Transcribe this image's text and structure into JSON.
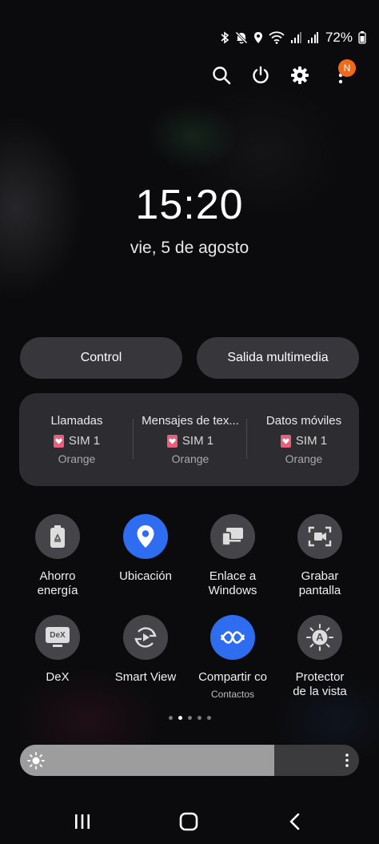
{
  "status_bar": {
    "battery_percent": "72%",
    "icons": [
      "bluetooth-icon",
      "mute-icon",
      "location-icon",
      "wifi-icon",
      "signal-icon",
      "signal-icon-2",
      "battery-icon"
    ]
  },
  "top_actions": {
    "icons": [
      "search-icon",
      "power-icon",
      "settings-icon",
      "more-options-icon"
    ],
    "notification_badge": "N"
  },
  "clock": {
    "time": "15:20",
    "date": "vie, 5 de agosto"
  },
  "pills": {
    "control": "Control",
    "media_output": "Salida multimedia"
  },
  "sim_panel": {
    "columns": [
      {
        "title": "Llamadas",
        "sim": "SIM 1",
        "carrier": "Orange"
      },
      {
        "title": "Mensajes de tex...",
        "sim": "SIM 1",
        "carrier": "Orange"
      },
      {
        "title": "Datos móviles",
        "sim": "SIM 1",
        "carrier": "Orange"
      }
    ]
  },
  "quick_tiles": [
    {
      "label_line1": "Ahorro",
      "label_line2": "energía",
      "active": false,
      "icon": "battery-saver-icon"
    },
    {
      "label_line1": "Ubicación",
      "label_line2": "",
      "active": true,
      "icon": "location-pin-icon"
    },
    {
      "label_line1": "Enlace a",
      "label_line2": "Windows",
      "active": false,
      "icon": "link-to-windows-icon"
    },
    {
      "label_line1": "Grabar",
      "label_line2": "pantalla",
      "active": false,
      "icon": "screen-record-icon"
    },
    {
      "label_line1": "DeX",
      "label_line2": "",
      "active": false,
      "icon": "dex-icon",
      "icon_text": "DeX"
    },
    {
      "label_line1": "Smart View",
      "label_line2": "",
      "active": false,
      "icon": "smart-view-icon"
    },
    {
      "label_line1": "Compartir co",
      "label_line2": "",
      "sublabel": "Contactos",
      "active": true,
      "icon": "quick-share-icon"
    },
    {
      "label_line1": "Protector",
      "label_line2": "de la vista",
      "active": false,
      "icon": "eye-comfort-icon",
      "icon_text": "A"
    }
  ],
  "page_indicator": {
    "count": 5,
    "active_index": 1
  },
  "brightness": {
    "level": 0.75
  },
  "colors": {
    "accent_blue": "#2f6df0",
    "badge_orange": "#f06a1a",
    "sim_pink": "#e4607c"
  },
  "nav_bar": {
    "icons": [
      "recents-icon",
      "home-icon",
      "back-icon"
    ]
  }
}
